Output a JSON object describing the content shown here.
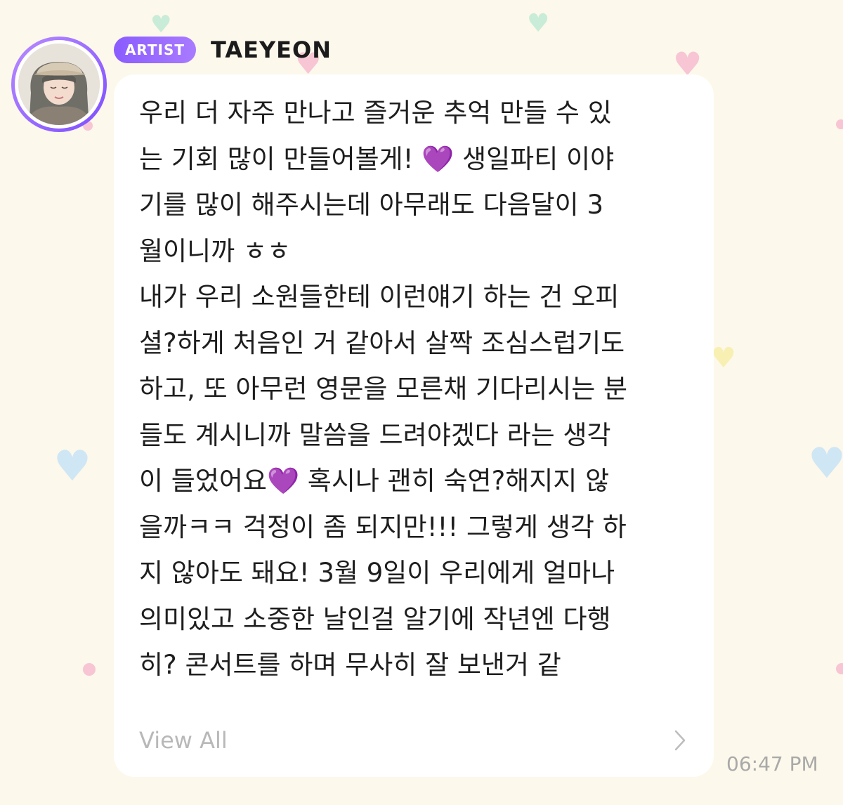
{
  "artist": {
    "badge": "ARTIST",
    "name": "TAEYEON"
  },
  "message": {
    "lines": [
      "우리 더 자주 만나고 즐거운 추억 만들 수 있",
      "는 기회 많이 만들어볼게! 💜 생일파티 이야",
      "기를 많이 해주시는데 아무래도 다음달이 3",
      "월이니까 ㅎㅎ",
      "내가 우리 소원들한테 이런얘기 하는 건 오피",
      "셜?하게 처음인 거 같아서 살짝 조심스럽기도",
      "하고, 또 아무런 영문을 모른채 기다리시는 분",
      "들도 계시니까 말씀을 드려야겠다 라는 생각",
      "이 들었어요💜 혹시나 괜히 숙연?해지지 않",
      "을까ㅋㅋ 걱정이 좀 되지만!!! 그렇게 생각 하",
      "지 않아도 돼요! 3월 9일이 우리에게 얼마나",
      "의미있고 소중한 날인걸 알기에 작년엔 다행",
      "히? 콘서트를 하며 무사히 잘 보낸거 같"
    ]
  },
  "view_all": "View All",
  "timestamp": "06:47 PM",
  "icons": {
    "avatar": "profile-photo",
    "chevron": "chevron-right-icon",
    "hearts": "heart-icon"
  },
  "colors": {
    "background": "#fcf8eb",
    "badge_start": "#8a5cff",
    "badge_end": "#a97bff",
    "bubble": "#ffffff",
    "text": "#1e1e1e",
    "muted": "#b8b8b8",
    "heart_pink": "#f7c5d3",
    "heart_mint": "#c8ecd7",
    "heart_blue": "#cfe6f5",
    "heart_yellow": "#f8f0b3"
  }
}
